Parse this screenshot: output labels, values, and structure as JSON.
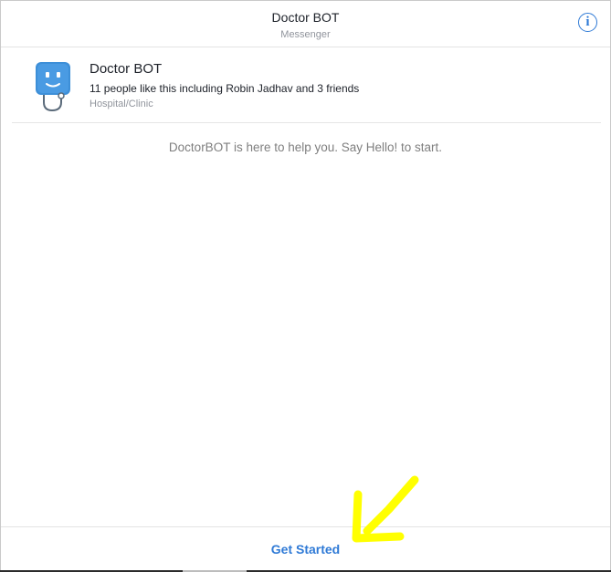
{
  "header": {
    "title": "Doctor BOT",
    "subtitle": "Messenger",
    "info_icon": "info-icon",
    "info_glyph": "i"
  },
  "page_card": {
    "name": "Doctor BOT",
    "likes": "11 people like this including Robin Jadhav and 3 friends",
    "category": "Hospital/Clinic",
    "avatar_icon": "robot-doctor-avatar"
  },
  "conversation": {
    "welcome": "DoctorBOT is here to help you. Say Hello! to start."
  },
  "footer": {
    "get_started_label": "Get Started"
  },
  "annotation": {
    "arrow_icon": "arrow-pointer-icon",
    "color": "#ffff00"
  },
  "colors": {
    "accent": "#2f7ad6",
    "avatar_blue": "#3d8fd8"
  }
}
